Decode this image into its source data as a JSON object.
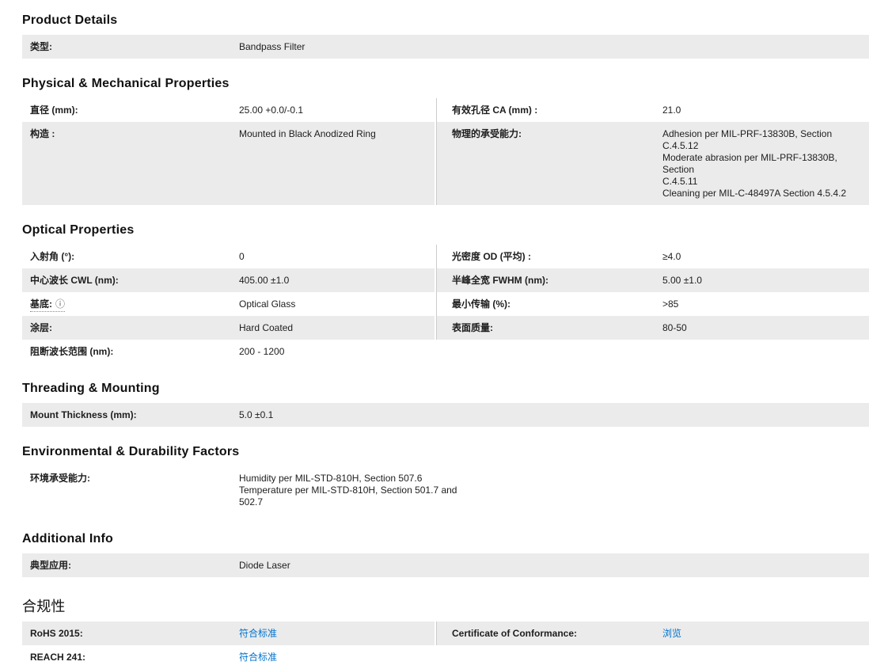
{
  "colors": {
    "row_shaded_bg": "#ebebeb",
    "text": "#1d1d1d",
    "link_blue": "#0072ce",
    "divider": "#cbcbcb"
  },
  "info_icon_glyph": "ⓘ",
  "sections": [
    {
      "id": "product-details",
      "title": "Product Details",
      "rows": [
        {
          "shaded": true,
          "cells": [
            {
              "label": "类型:",
              "value": "Bandpass Filter"
            }
          ]
        }
      ]
    },
    {
      "id": "physical-mechanical-properties",
      "title": "Physical & Mechanical Properties",
      "rows": [
        {
          "shaded": false,
          "cells": [
            {
              "label": "直径 (mm):",
              "value": "25.00 +0.0/-0.1"
            },
            {
              "label": "有效孔径 CA (mm) :",
              "value": "21.0"
            }
          ]
        },
        {
          "shaded": true,
          "cells": [
            {
              "label": "构造 :",
              "value": "Mounted in Black Anodized Ring"
            },
            {
              "label": "物理的承受能力:",
              "value": "Adhesion per MIL-PRF-13830B, Section C.4.5.12\nModerate abrasion per MIL-PRF-13830B, Section\nC.4.5.11\nCleaning per MIL-C-48497A Section 4.5.4.2"
            }
          ]
        }
      ]
    },
    {
      "id": "optical-properties",
      "title": "Optical Properties",
      "rows": [
        {
          "shaded": false,
          "cells": [
            {
              "label": "入射角 (°):",
              "value": "0"
            },
            {
              "label": "光密度 OD (平均) :",
              "value": "≥4.0"
            }
          ]
        },
        {
          "shaded": true,
          "cells": [
            {
              "label": "中心波长 CWL (nm):",
              "value": "405.00 ±1.0"
            },
            {
              "label": "半峰全宽 FWHM (nm):",
              "value": "5.00 ±1.0"
            }
          ]
        },
        {
          "shaded": false,
          "cells": [
            {
              "label": "基底:",
              "info": true,
              "value": "Optical Glass"
            },
            {
              "label": "最小传输 (%):",
              "value": ">85"
            }
          ]
        },
        {
          "shaded": true,
          "cells": [
            {
              "label": "涂层:",
              "value": "Hard Coated"
            },
            {
              "label": "表面质量:",
              "value": "80-50"
            }
          ]
        },
        {
          "shaded": false,
          "cells": [
            {
              "label": "阻断波长范围 (nm):",
              "value": "200 - 1200"
            }
          ]
        }
      ]
    },
    {
      "id": "threading-mounting",
      "title": "Threading & Mounting",
      "rows": [
        {
          "shaded": true,
          "cells": [
            {
              "label": "Mount Thickness (mm):",
              "value": "5.0 ±0.1"
            }
          ]
        }
      ]
    },
    {
      "id": "environmental-durability-factors",
      "title": "Environmental & Durability Factors",
      "rows": [
        {
          "shaded": false,
          "cells": [
            {
              "label": "环境承受能力:",
              "value": "Humidity per MIL-STD-810H, Section 507.6\nTemperature per MIL-STD-810H, Section 501.7 and\n502.7"
            }
          ]
        }
      ]
    },
    {
      "id": "additional-info",
      "title": "Additional Info",
      "rows": [
        {
          "shaded": true,
          "cells": [
            {
              "label": "典型应用:",
              "value": "Diode Laser"
            }
          ]
        }
      ]
    },
    {
      "id": "compliance",
      "title": "合规性",
      "cjk": true,
      "rows": [
        {
          "shaded": true,
          "cells": [
            {
              "label": "RoHS 2015:",
              "value": "符合标准",
              "link": true
            },
            {
              "label": "Certificate of Conformance:",
              "value": "浏览",
              "link": true
            }
          ]
        },
        {
          "shaded": false,
          "cells": [
            {
              "label": "REACH 241:",
              "value": "符合标准",
              "link": true
            }
          ]
        }
      ]
    }
  ]
}
